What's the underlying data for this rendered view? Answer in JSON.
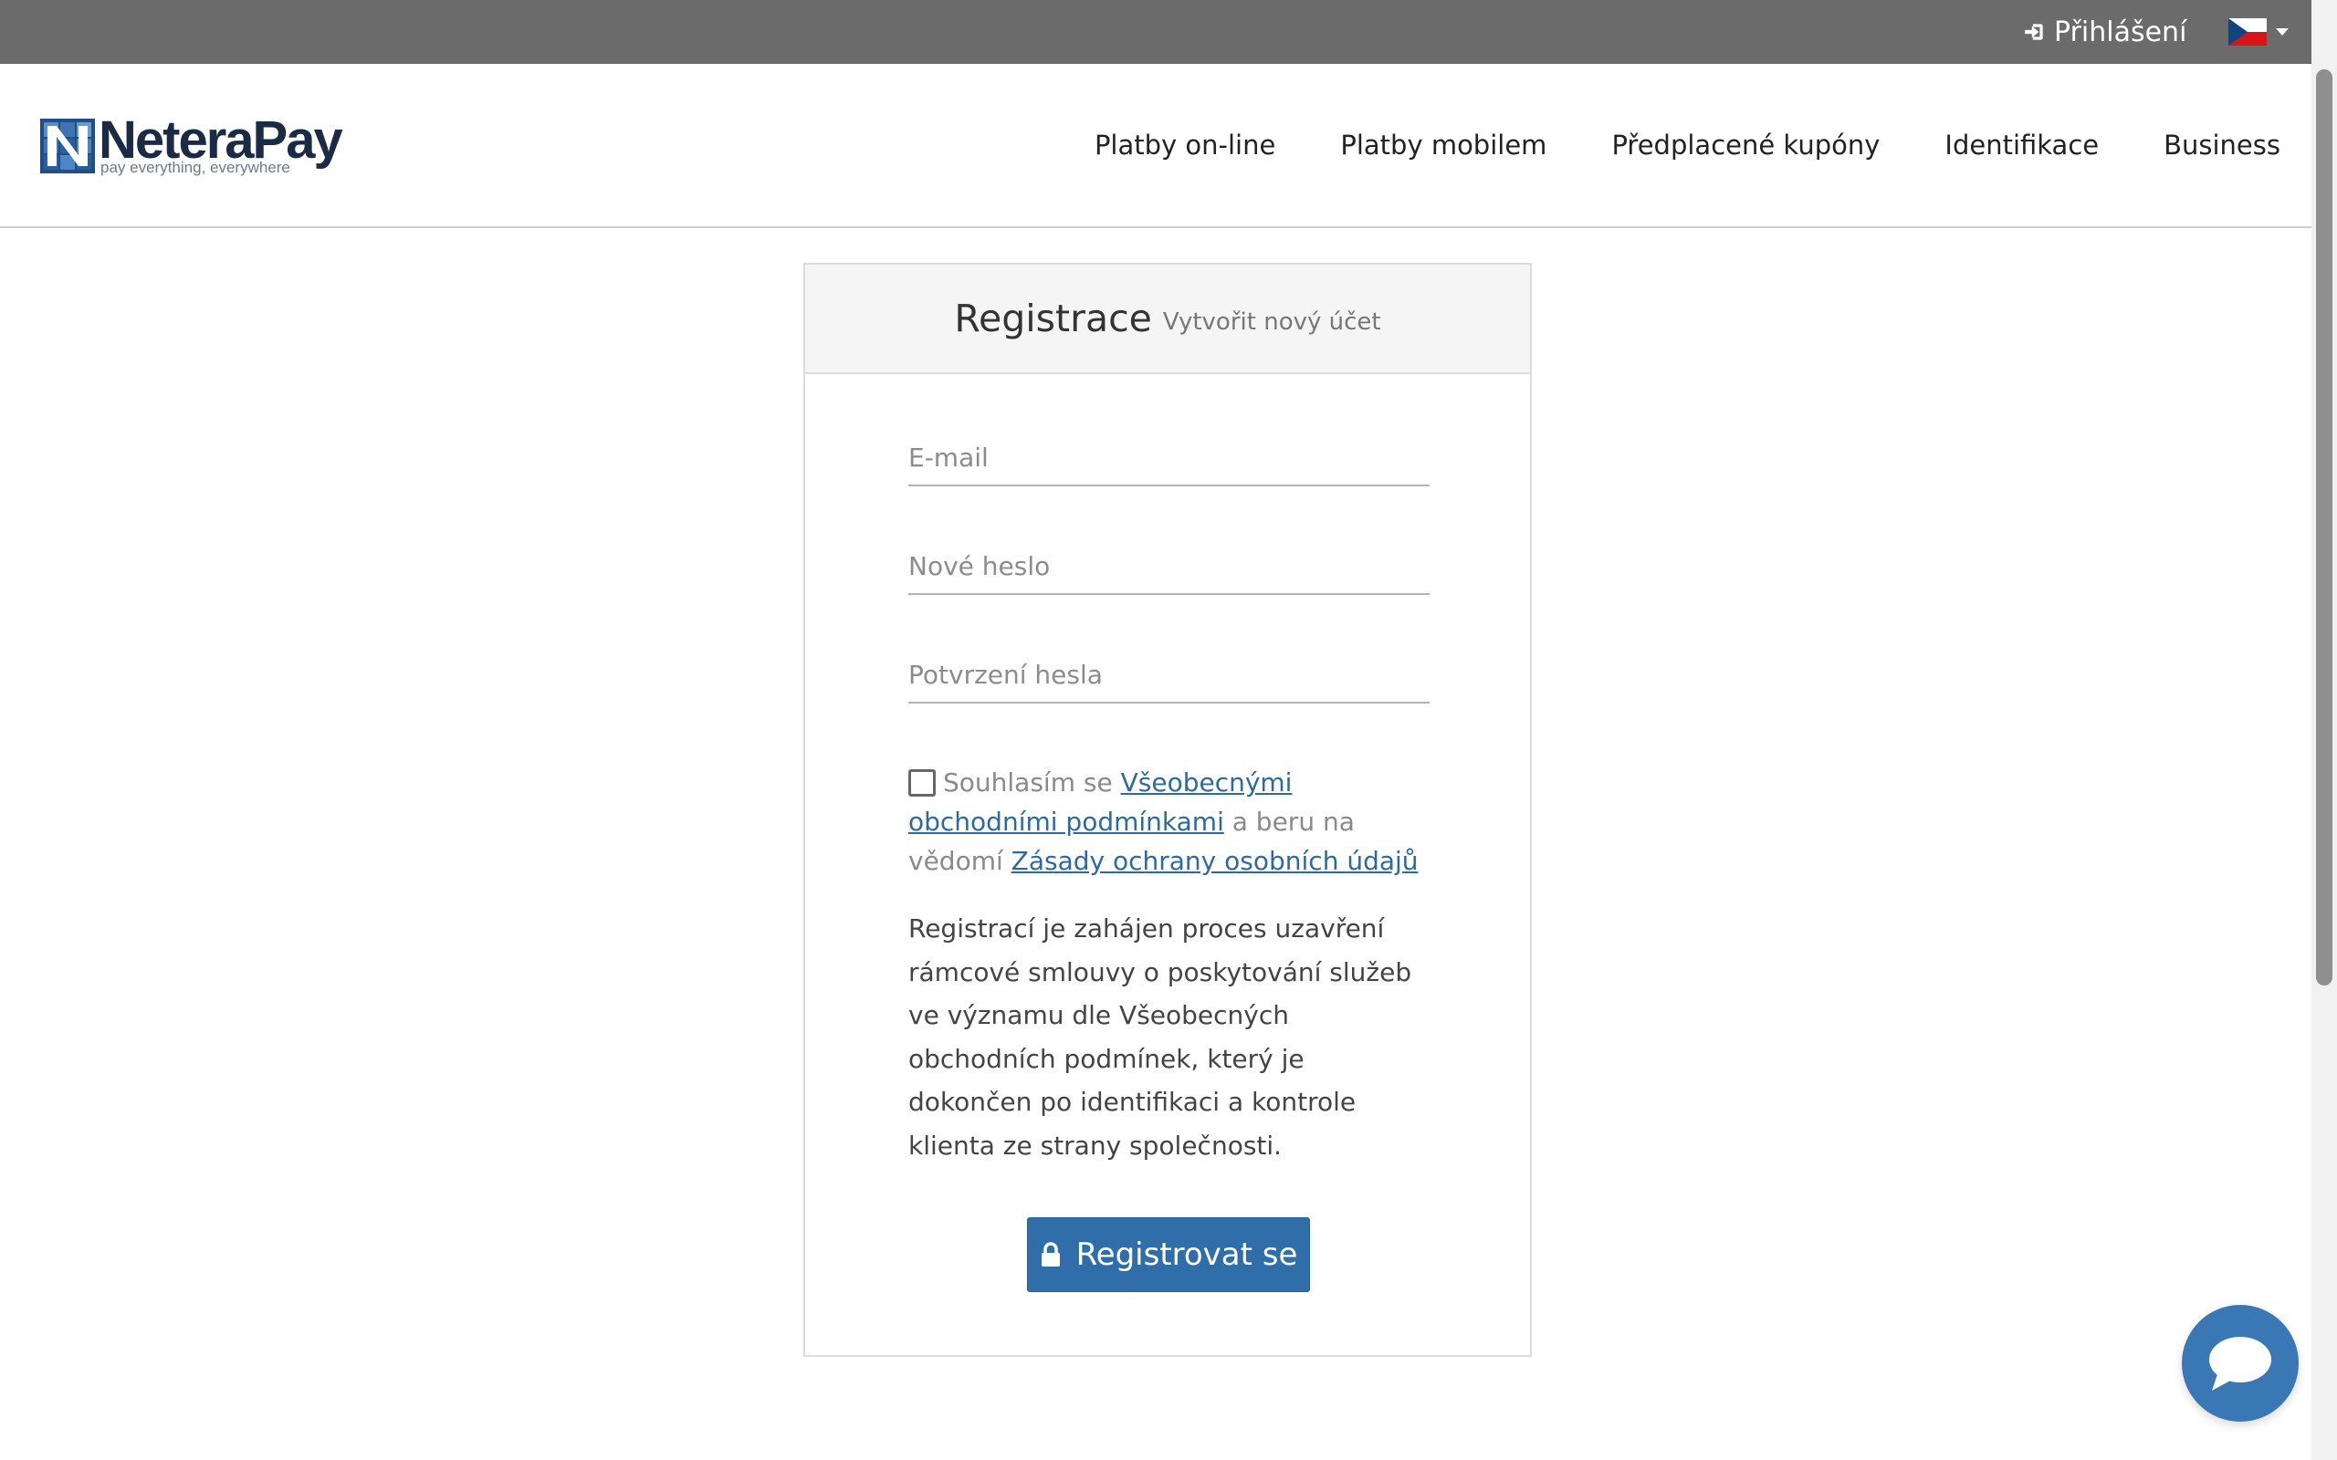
{
  "topbar": {
    "login_label": "Přihlášení",
    "language": "Czech",
    "background_color": "#6b6b6b"
  },
  "header": {
    "logo_name": "NeteraPay",
    "logo_tagline": "pay everything, everywhere",
    "nav": [
      "Platby on-line",
      "Platby mobilem",
      "Předplacené kupóny",
      "Identifikace",
      "Business"
    ]
  },
  "form": {
    "title": "Registrace",
    "subtitle": "Vytvořit nový účet",
    "email_placeholder": "E-mail",
    "password_placeholder": "Nové heslo",
    "confirm_placeholder": "Potvrzení hesla",
    "consent": {
      "checked": false,
      "prefix": "Souhlasím se ",
      "terms_link": "Všeobecnými obchodními podmínkami",
      "middle": " a beru na vědomí ",
      "privacy_link": "Zásady ochrany osobních údajů"
    },
    "info_text": "Registrací je zahájen proces uzavření rámcové smlouvy o poskytování služeb ve významu dle Všeobecných obchodních podmínek, který je dokončen po identifikaci a kontrole klienta ze strany společnosti.",
    "submit_label": "Registrovat se",
    "accent_color": "#2f6ea9"
  },
  "icons": {
    "login": "sign-in-icon",
    "flag": "czech-flag-icon",
    "submit": "lock-icon",
    "chat": "chat-bubble-icon"
  }
}
